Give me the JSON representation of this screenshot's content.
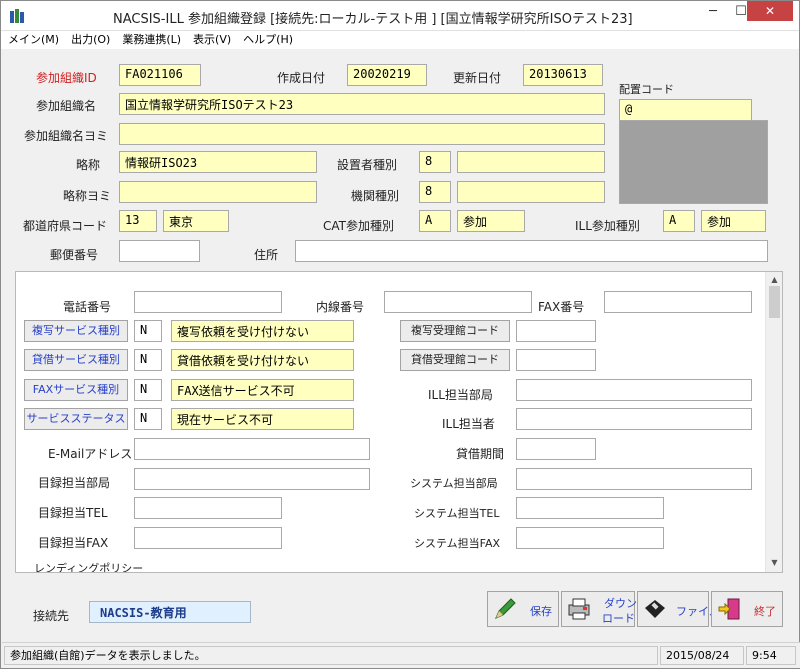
{
  "window": {
    "title": "NACSIS-ILL 参加組織登録 [接続先:ローカル-テスト用 ] [国立情報学研究所ISOテスト23]",
    "minimize": "─",
    "maximize": "☐",
    "close": "✕"
  },
  "menu": [
    "メイン(M)",
    "出力(O)",
    "業務連携(L)",
    "表示(V)",
    "ヘルプ(H)"
  ],
  "form": {
    "id_label": "参加組織ID",
    "id_value": "FA021106",
    "created_label": "作成日付",
    "created_value": "20020219",
    "updated_label": "更新日付",
    "updated_value": "20130613",
    "name_label": "参加組織名",
    "name_value": "国立情報学研究所ISOテスト23",
    "name_kana_label": "参加組織名ヨミ",
    "name_kana_value": "",
    "abbr_label": "略称",
    "abbr_value": "情報研ISO23",
    "abbr_kana_label": "略称ヨミ",
    "abbr_kana_value": "",
    "founder_label": "設置者種別",
    "founder_code": "8",
    "founder_name": "",
    "org_type_label": "機関種別",
    "org_type_code": "8",
    "org_type_name": "",
    "pref_label": "都道府県コード",
    "pref_code": "13",
    "pref_name": "東京",
    "cat_label": "CAT参加種別",
    "cat_code": "A",
    "cat_name": "参加",
    "ill_label": "ILL参加種別",
    "ill_code": "A",
    "ill_name": "参加",
    "zip_label": "郵便番号",
    "zip_value": "",
    "address_label": "住所",
    "address_value": "",
    "location_label": "配置コード",
    "location_value": "@"
  },
  "panel": {
    "tel_label": "電話番号",
    "tel_value": "",
    "ext_label": "内線番号",
    "ext_value": "",
    "fax_label": "FAX番号",
    "fax_value": "",
    "copy_service_btn": "複写サービス種別",
    "copy_service_code": "N",
    "copy_service_desc": "複写依頼を受け付けない",
    "loan_service_btn": "貸借サービス種別",
    "loan_service_code": "N",
    "loan_service_desc": "貸借依頼を受け付けない",
    "fax_service_btn": "FAXサービス種別",
    "fax_service_code": "N",
    "fax_service_desc": "FAX送信サービス不可",
    "service_status_btn": "サービスステータス",
    "service_status_code": "N",
    "service_status_desc": "現在サービス不可",
    "copy_recv_btn": "複写受理館コード",
    "copy_recv_value": "",
    "loan_recv_btn": "貸借受理館コード",
    "loan_recv_value": "",
    "ill_dept_label": "ILL担当部局",
    "ill_dept_value": "",
    "ill_person_label": "ILL担当者",
    "ill_person_value": "",
    "email_label": "E-Mailアドレス",
    "email_value": "",
    "loan_period_label": "貸借期間",
    "loan_period_value": "",
    "cat_dept_label": "目録担当部局",
    "cat_dept_value": "",
    "sys_dept_label": "システム担当部局",
    "sys_dept_value": "",
    "cat_tel_label": "目録担当TEL",
    "cat_tel_value": "",
    "sys_tel_label": "システム担当TEL",
    "sys_tel_value": "",
    "cat_fax_label": "目録担当FAX",
    "cat_fax_value": "",
    "sys_fax_label": "システム担当FAX",
    "sys_fax_value": "",
    "lending_policy_label": "レンディングポリシー"
  },
  "footer": {
    "conn_label": "接続先",
    "conn_value": "NACSIS-教育用",
    "save": "保存",
    "download_1": "ダウン",
    "download_2": "ロード",
    "file": "ファイル",
    "exit": "終了"
  },
  "status": {
    "message": "参加組織(自館)データを表示しました。",
    "date": "2015/08/24",
    "time": "9:54"
  },
  "colors": {
    "required_label": "#d21f1f",
    "input_yellow": "#ffffc0",
    "link_blue": "#2840c8",
    "close_red": "#c74343"
  }
}
